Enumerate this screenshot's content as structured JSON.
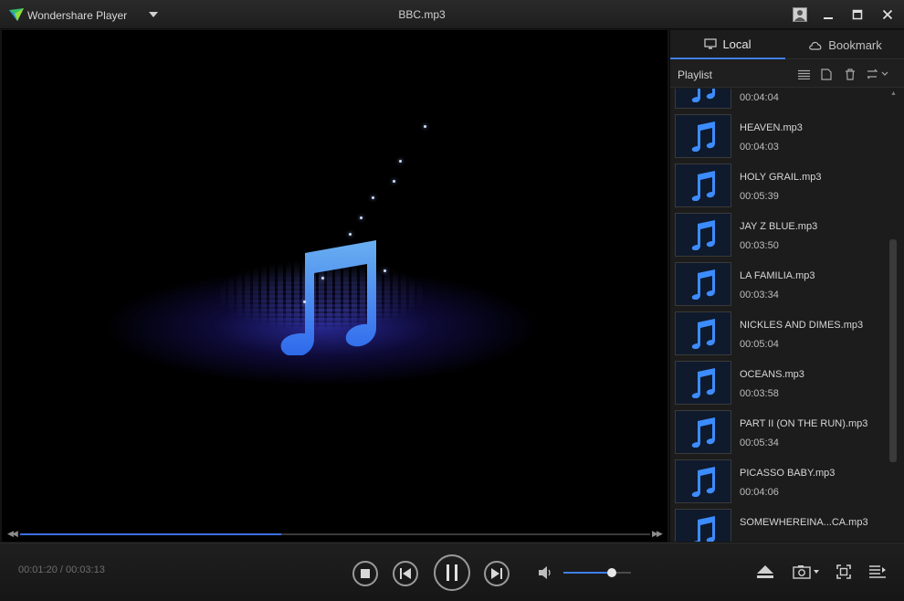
{
  "app": {
    "name": "Wondershare Player",
    "window_title": "BBC.mp3"
  },
  "panel": {
    "tabs": [
      {
        "label": "Local",
        "icon": "monitor-icon",
        "active": true
      },
      {
        "label": "Bookmark",
        "icon": "cloud-icon",
        "active": false
      }
    ],
    "playlist_label": "Playlist",
    "tools": [
      "list-view-icon",
      "new-file-icon",
      "trash-icon",
      "sort-icon"
    ],
    "items": [
      {
        "name": "",
        "duration": "00:04:04"
      },
      {
        "name": "HEAVEN.mp3",
        "duration": "00:04:03"
      },
      {
        "name": "HOLY GRAIL.mp3",
        "duration": "00:05:39"
      },
      {
        "name": "JAY Z BLUE.mp3",
        "duration": "00:03:50"
      },
      {
        "name": "LA FAMILIA.mp3",
        "duration": "00:03:34"
      },
      {
        "name": "NICKLES AND DIMES.mp3",
        "duration": "00:05:04"
      },
      {
        "name": "OCEANS.mp3",
        "duration": "00:03:58"
      },
      {
        "name": "PART II (ON THE RUN).mp3",
        "duration": "00:05:34"
      },
      {
        "name": "PICASSO BABY.mp3",
        "duration": "00:04:06"
      },
      {
        "name": "SOMEWHEREINA...CA.mp3",
        "duration": ""
      }
    ]
  },
  "playback": {
    "time_display": "00:01:20 / 00:03:13",
    "progress_fraction": 0.415,
    "volume_fraction": 0.72
  },
  "colors": {
    "accent": "#3f7fe8",
    "note_blue": "#3d8cff"
  }
}
